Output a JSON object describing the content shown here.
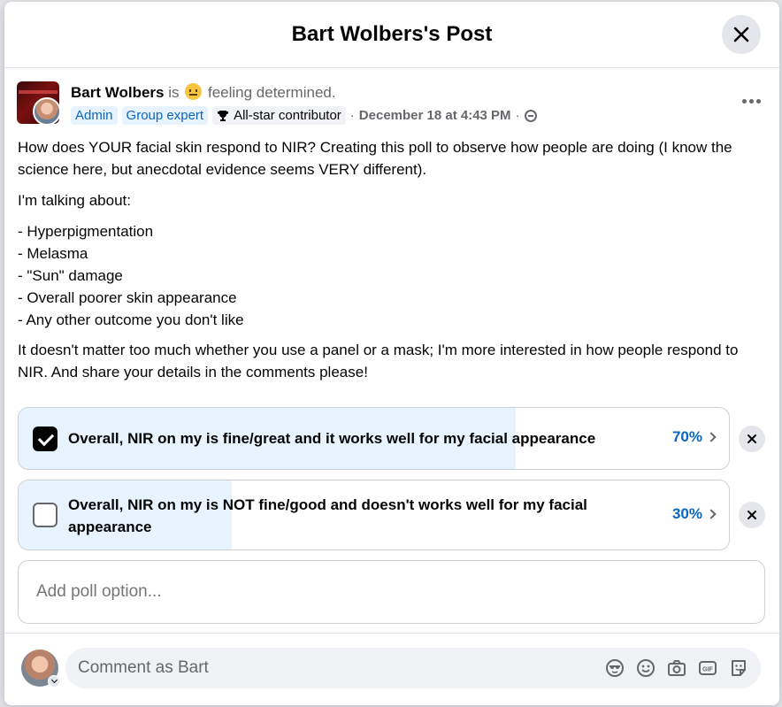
{
  "header": {
    "title": "Bart Wolbers's Post"
  },
  "post": {
    "author": "Bart Wolbers",
    "is_word": "is",
    "feeling": "feeling determined.",
    "badges": {
      "admin": "Admin",
      "expert": "Group expert",
      "contributor": "All-star contributor"
    },
    "timestamp": "December 18 at 4:43 PM",
    "separator": "·",
    "paragraphs": [
      "How does YOUR facial skin respond to NIR? Creating this poll to observe how people are doing (I know the science here, but anecdotal evidence seems VERY different).",
      "I'm talking about:"
    ],
    "list": [
      "- Hyperpigmentation",
      "- Melasma",
      "- \"Sun\" damage",
      "- Overall poorer skin appearance",
      "- Any other outcome you don't like"
    ],
    "closing": "It doesn't matter too much whether you use a panel or a mask; I'm more interested in how people respond to NIR. And share your details in the comments please!"
  },
  "poll": {
    "options": [
      {
        "label": "Overall, NIR on my is fine/great and it works well for my facial appearance",
        "percent_label": "70%",
        "percent": 70,
        "checked": true
      },
      {
        "label": "Overall, NIR on my is NOT fine/good and doesn't works well for my facial appearance",
        "percent_label": "30%",
        "percent": 30,
        "checked": false
      }
    ],
    "add_placeholder": "Add poll option..."
  },
  "comment": {
    "placeholder": "Comment as Bart"
  },
  "colors": {
    "accent": "#0a66c2",
    "poll_fill": "#e7f3ff"
  }
}
